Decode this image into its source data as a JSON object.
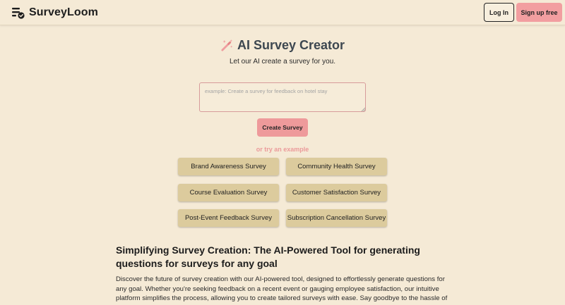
{
  "header": {
    "brand": "SurveyLoom",
    "login_label": "Log In",
    "signup_label": "Sign up free"
  },
  "hero": {
    "title": "AI Survey Creator",
    "subtitle": "Let our AI create a survey for you.",
    "prompt_placeholder": "example: Create a survey for feedback on hotel stay",
    "prompt_value": "",
    "create_label": "Create Survey",
    "or_try": "or try an example"
  },
  "examples": [
    "Brand Awareness Survey",
    "Community Health Survey",
    "Course Evaluation Survey",
    "Customer Satisfaction Survey",
    "Post-Event Feedback Survey",
    "Subscription Cancellation Survey"
  ],
  "article": {
    "heading": "Simplifying Survey Creation: The AI-Powered Tool for generating questions for surveys for any goal",
    "paragraph": "Discover the future of survey creation with our AI-powered tool, designed to effortlessly generate questions for any goal. Whether you're seeking feedback on a recent event or gauging employee satisfaction, our intuitive platform simplifies the process, allowing you to create tailored surveys with ease. Say goodbye to the hassle of manual"
  },
  "colors": {
    "background": "#f5ead6",
    "accent_pink": "#ee9a9b",
    "example_button": "#dccb9d",
    "title_text": "#3d4750"
  },
  "icons": {
    "brand": "survey-list-check-icon",
    "title": "magic-wand-icon"
  }
}
